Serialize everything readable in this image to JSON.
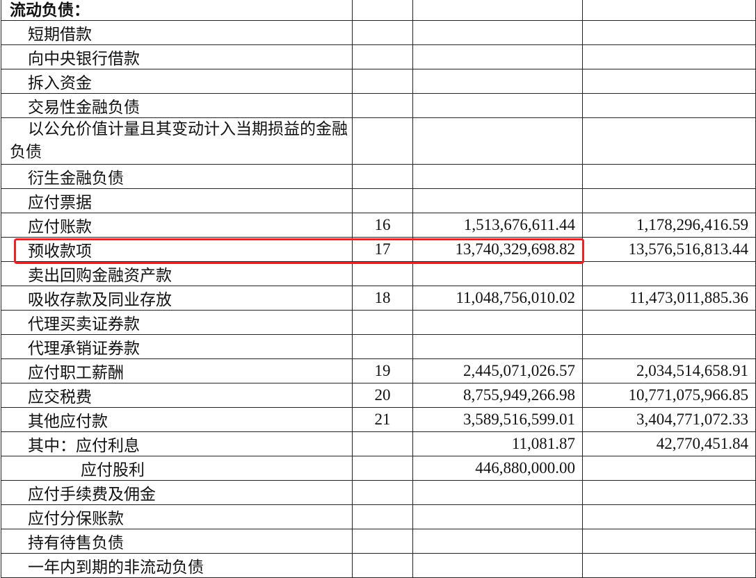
{
  "rows": [
    {
      "label": "流动负债：",
      "note": "",
      "current": "",
      "previous": ""
    },
    {
      "label": "短期借款",
      "note": "",
      "current": "",
      "previous": ""
    },
    {
      "label": "向中央银行借款",
      "note": "",
      "current": "",
      "previous": ""
    },
    {
      "label": "拆入资金",
      "note": "",
      "current": "",
      "previous": ""
    },
    {
      "label": "交易性金融负债",
      "note": "",
      "current": "",
      "previous": ""
    },
    {
      "label": "以公允价值计量且其变动计入当期损益的金融负债",
      "note": "",
      "current": "",
      "previous": ""
    },
    {
      "label": "衍生金融负债",
      "note": "",
      "current": "",
      "previous": ""
    },
    {
      "label": "应付票据",
      "note": "",
      "current": "",
      "previous": ""
    },
    {
      "label": "应付账款",
      "note": "16",
      "current": "1,513,676,611.44",
      "previous": "1,178,296,416.59"
    },
    {
      "label": "预收款项",
      "note": "17",
      "current": "13,740,329,698.82",
      "previous": "13,576,516,813.44"
    },
    {
      "label": "卖出回购金融资产款",
      "note": "",
      "current": "",
      "previous": ""
    },
    {
      "label": "吸收存款及同业存放",
      "note": "18",
      "current": "11,048,756,010.02",
      "previous": "11,473,011,885.36"
    },
    {
      "label": "代理买卖证券款",
      "note": "",
      "current": "",
      "previous": ""
    },
    {
      "label": "代理承销证券款",
      "note": "",
      "current": "",
      "previous": ""
    },
    {
      "label": "应付职工薪酬",
      "note": "19",
      "current": "2,445,071,026.57",
      "previous": "2,034,514,658.91"
    },
    {
      "label": "应交税费",
      "note": "20",
      "current": "8,755,949,266.98",
      "previous": "10,771,075,966.85"
    },
    {
      "label": "其他应付款",
      "note": "21",
      "current": "3,589,516,599.01",
      "previous": "3,404,771,072.33"
    },
    {
      "label": "其中：应付利息",
      "note": "",
      "current": "11,081.87",
      "previous": "42,770,451.84"
    },
    {
      "label": "应付股利",
      "note": "",
      "current": "446,880,000.00",
      "previous": ""
    },
    {
      "label": "应付手续费及佣金",
      "note": "",
      "current": "",
      "previous": ""
    },
    {
      "label": "应付分保账款",
      "note": "",
      "current": "",
      "previous": ""
    },
    {
      "label": "持有待售负债",
      "note": "",
      "current": "",
      "previous": ""
    },
    {
      "label": "一年内到期的非流动负债",
      "note": "",
      "current": "",
      "previous": ""
    }
  ],
  "highlight": {
    "color": "#e8232a",
    "row_index": 9
  }
}
